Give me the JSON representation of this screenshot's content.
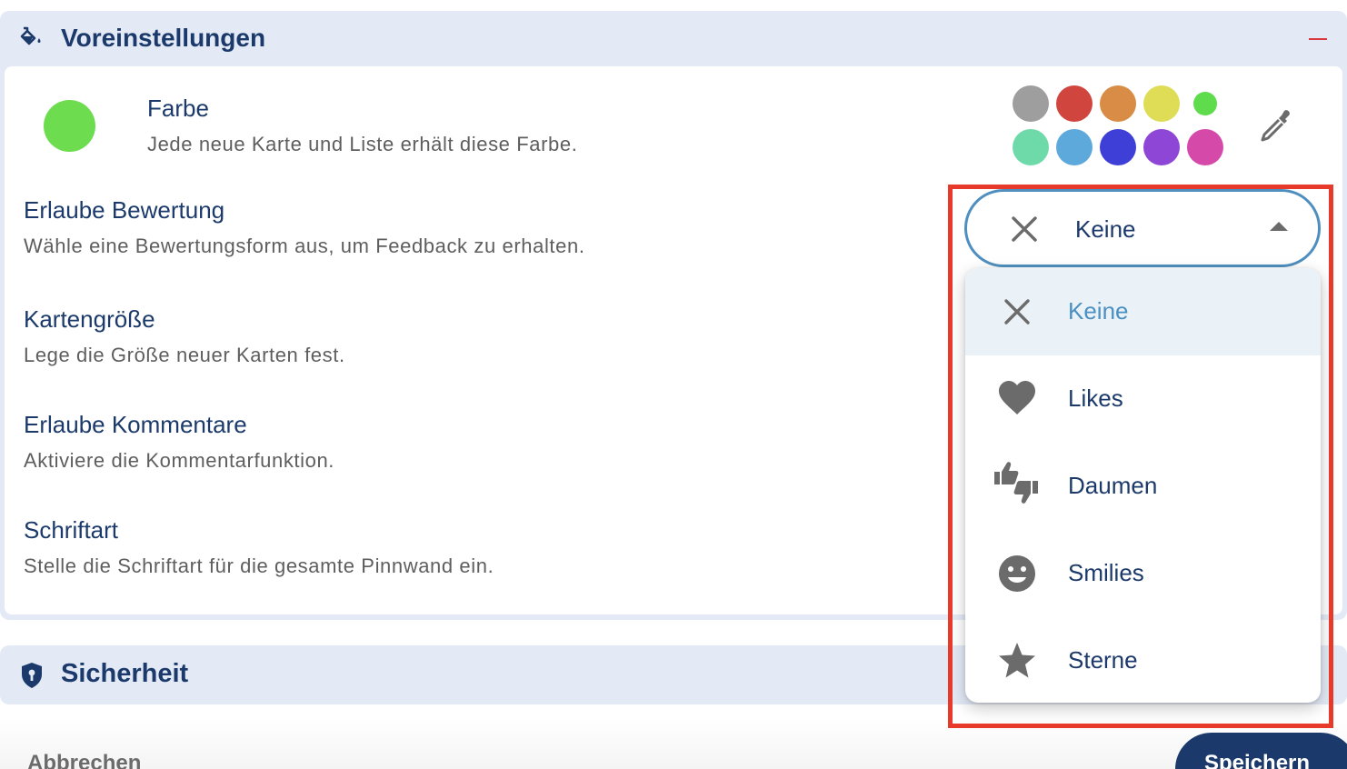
{
  "colors": {
    "accent": "#1b3a6b",
    "selected_color": "#6ddc4f",
    "highlight_border": "#e83a2a",
    "palette": [
      "#9e9e9e",
      "#d1453f",
      "#d88c45",
      "#dedd55",
      "#5fdc4c",
      "#6edaa9",
      "#5ea9dc",
      "#3d3fd7",
      "#8e46d7",
      "#d54aa9"
    ]
  },
  "defaults_section": {
    "title": "Voreinstellungen",
    "icon": "paint-bucket-icon",
    "collapse_icon": "minus-icon"
  },
  "settings": {
    "color": {
      "title": "Farbe",
      "description": "Jede neue Karte und Liste erhält diese Farbe.",
      "eyedropper_icon": "eyedropper-icon"
    },
    "rating": {
      "title": "Erlaube Bewertung",
      "description": "Wähle eine Bewertungsform aus, um Feedback zu erhalten."
    },
    "card_size": {
      "title": "Kartengröße",
      "description": "Lege die Größe neuer Karten fest."
    },
    "comments": {
      "title": "Erlaube Kommentare",
      "description": "Aktiviere die Kommentarfunktion."
    },
    "font": {
      "title": "Schriftart",
      "description": "Stelle die Schriftart für die gesamte Pinnwand ein."
    }
  },
  "rating_select": {
    "value": "Keine",
    "options": [
      {
        "label": "Keine",
        "icon": "close-icon",
        "selected": true
      },
      {
        "label": "Likes",
        "icon": "heart-icon",
        "selected": false
      },
      {
        "label": "Daumen",
        "icon": "thumbs-up-down-icon",
        "selected": false
      },
      {
        "label": "Smilies",
        "icon": "smiley-icon",
        "selected": false
      },
      {
        "label": "Sterne",
        "icon": "star-icon",
        "selected": false
      }
    ]
  },
  "security_section": {
    "title": "Sicherheit",
    "icon": "shield-lock-icon"
  },
  "footer": {
    "cancel_label": "Abbrechen",
    "save_label": "Speichern"
  }
}
